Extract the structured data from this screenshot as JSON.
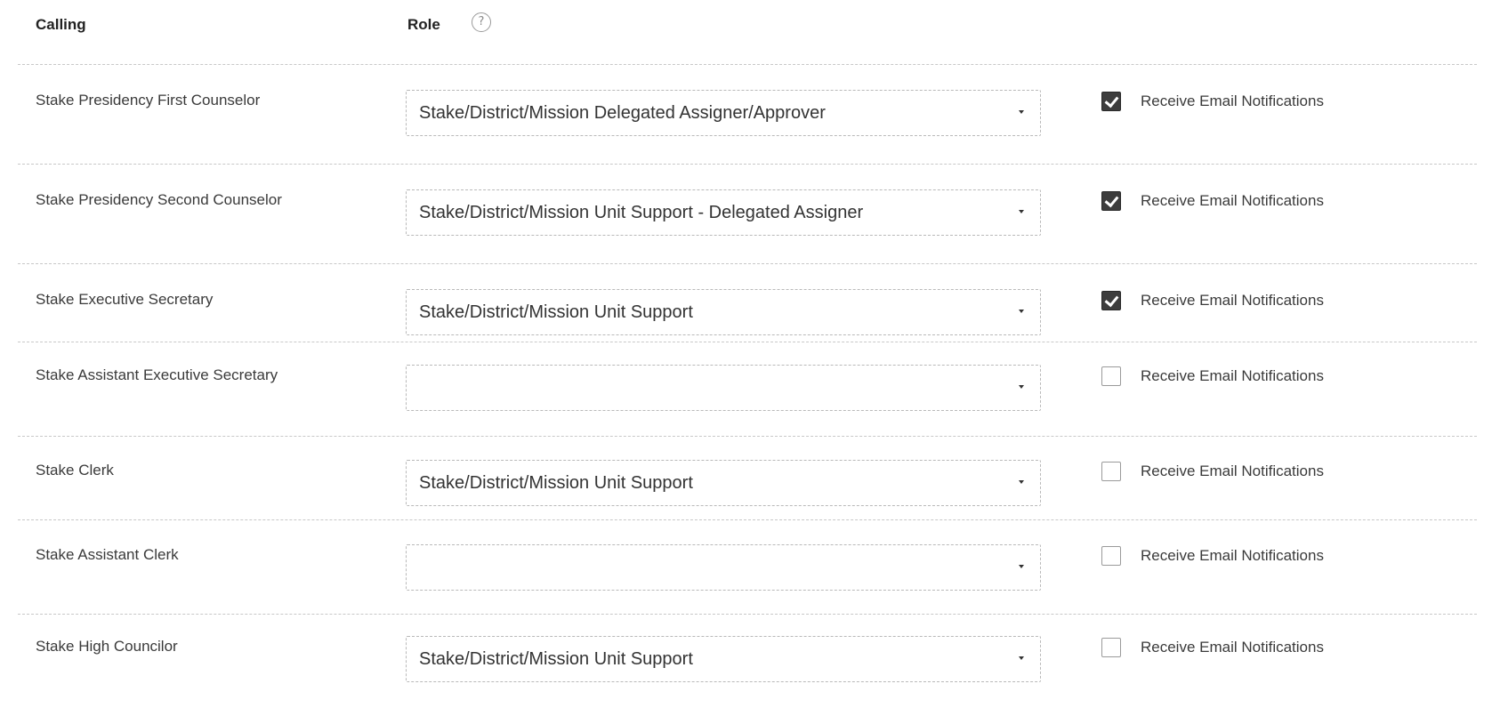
{
  "header": {
    "calling_label": "Calling",
    "role_label": "Role",
    "help_glyph": "?"
  },
  "rows": [
    {
      "calling": "Stake Presidency First Counselor",
      "role": "Stake/District/Mission Delegated Assigner/Approver",
      "notify_label": "Receive Email Notifications",
      "notify_checked": true
    },
    {
      "calling": "Stake Presidency Second Counselor",
      "role": "Stake/District/Mission Unit Support - Delegated Assigner",
      "notify_label": "Receive Email Notifications",
      "notify_checked": true
    },
    {
      "calling": "Stake Executive Secretary",
      "role": "Stake/District/Mission Unit Support",
      "notify_label": "Receive Email Notifications",
      "notify_checked": true
    },
    {
      "calling": "Stake Assistant Executive Secretary",
      "role": "",
      "notify_label": "Receive Email Notifications",
      "notify_checked": false
    },
    {
      "calling": "Stake Clerk",
      "role": "Stake/District/Mission Unit Support",
      "notify_label": "Receive Email Notifications",
      "notify_checked": false
    },
    {
      "calling": "Stake Assistant Clerk",
      "role": "",
      "notify_label": "Receive Email Notifications",
      "notify_checked": false
    },
    {
      "calling": "Stake High Councilor",
      "role": "Stake/District/Mission Unit Support",
      "notify_label": "Receive Email Notifications",
      "notify_checked": false
    }
  ]
}
